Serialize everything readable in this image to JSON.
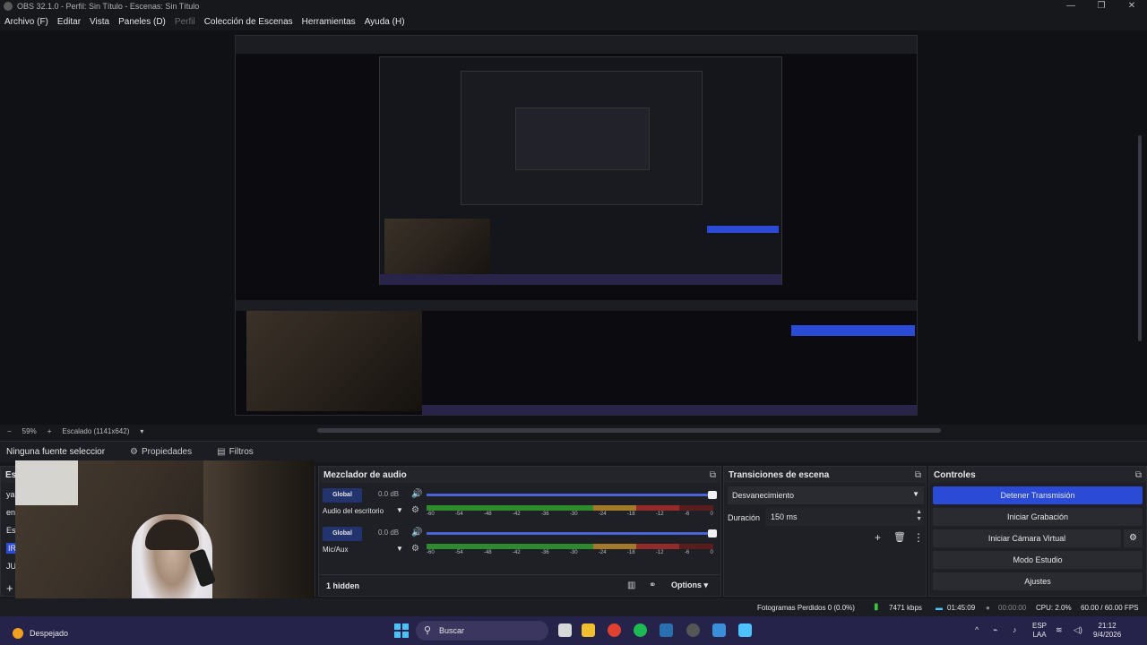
{
  "window": {
    "title": "OBS 32.1.0 - Perfil: Sin Título - Escenas: Sin Título",
    "minimize": "—",
    "maximize": "❐",
    "close": "✕"
  },
  "menu": [
    "Archivo (F)",
    "Editar",
    "Vista",
    "Paneles (D)",
    "Perfil",
    "Colección de Escenas",
    "Herramientas",
    "Ayuda (H)"
  ],
  "zoom": {
    "minus": "−",
    "value": "59%",
    "plus": "+",
    "scale_label": "Escalado (1141x642)",
    "arrow": "▾"
  },
  "context": {
    "no_source": "Ninguna fuente seleccionada",
    "properties": "Propiedades",
    "filters": "Filtros"
  },
  "scenes": {
    "title": "Escenas",
    "items": [
      "ya",
      "en",
      "Esc",
      "IRL",
      "JUE"
    ],
    "selected_index": 3,
    "add": "+"
  },
  "weather": {
    "label": "Despejado"
  },
  "mixer": {
    "title": "Mezclador de audio",
    "channels": [
      {
        "global_label": "Global",
        "db": "0.0 dB",
        "name": "Audio del escritorio",
        "level": 0.72
      },
      {
        "global_label": "Global",
        "db": "0.0 dB",
        "name": "Mic/Aux",
        "level": 0.85
      }
    ],
    "scale": [
      "-60",
      "-54",
      "-48",
      "-42",
      "-36",
      "-30",
      "-24",
      "-18",
      "-12",
      "-6",
      "0"
    ],
    "hidden_label": "1 hidden",
    "options_label": "Options"
  },
  "transitions": {
    "title": "Transiciones de escena",
    "selected": "Desvanecimiento",
    "duration_label": "Duración",
    "duration_value": "150 ms"
  },
  "controls": {
    "title": "Controles",
    "stop_stream": "Detener Transmisión",
    "start_record": "Iniciar Grabación",
    "start_virtual_cam": "Iniciar Cámara Virtual",
    "studio_mode": "Modo Estudio",
    "settings": "Ajustes"
  },
  "status": {
    "dropped": "Fotogramas Perdidos 0 (0.0%)",
    "bitrate": "7471 kbps",
    "stream_time": "01:45:09",
    "rec_time": "00:00:00",
    "cpu": "CPU: 2.0%",
    "fps": "60.00 / 60.00 FPS"
  },
  "taskbar": {
    "search": "Buscar",
    "lang1": "ESP",
    "lang2": "LAA",
    "time": "21:12",
    "date": "9/4/2026"
  },
  "colors": {
    "accent": "#2b4bd6",
    "meter_green": "#2d8a2d",
    "meter_yellow": "#a37a2a",
    "meter_red": "#932b2b",
    "taskbar": "#26234a"
  }
}
